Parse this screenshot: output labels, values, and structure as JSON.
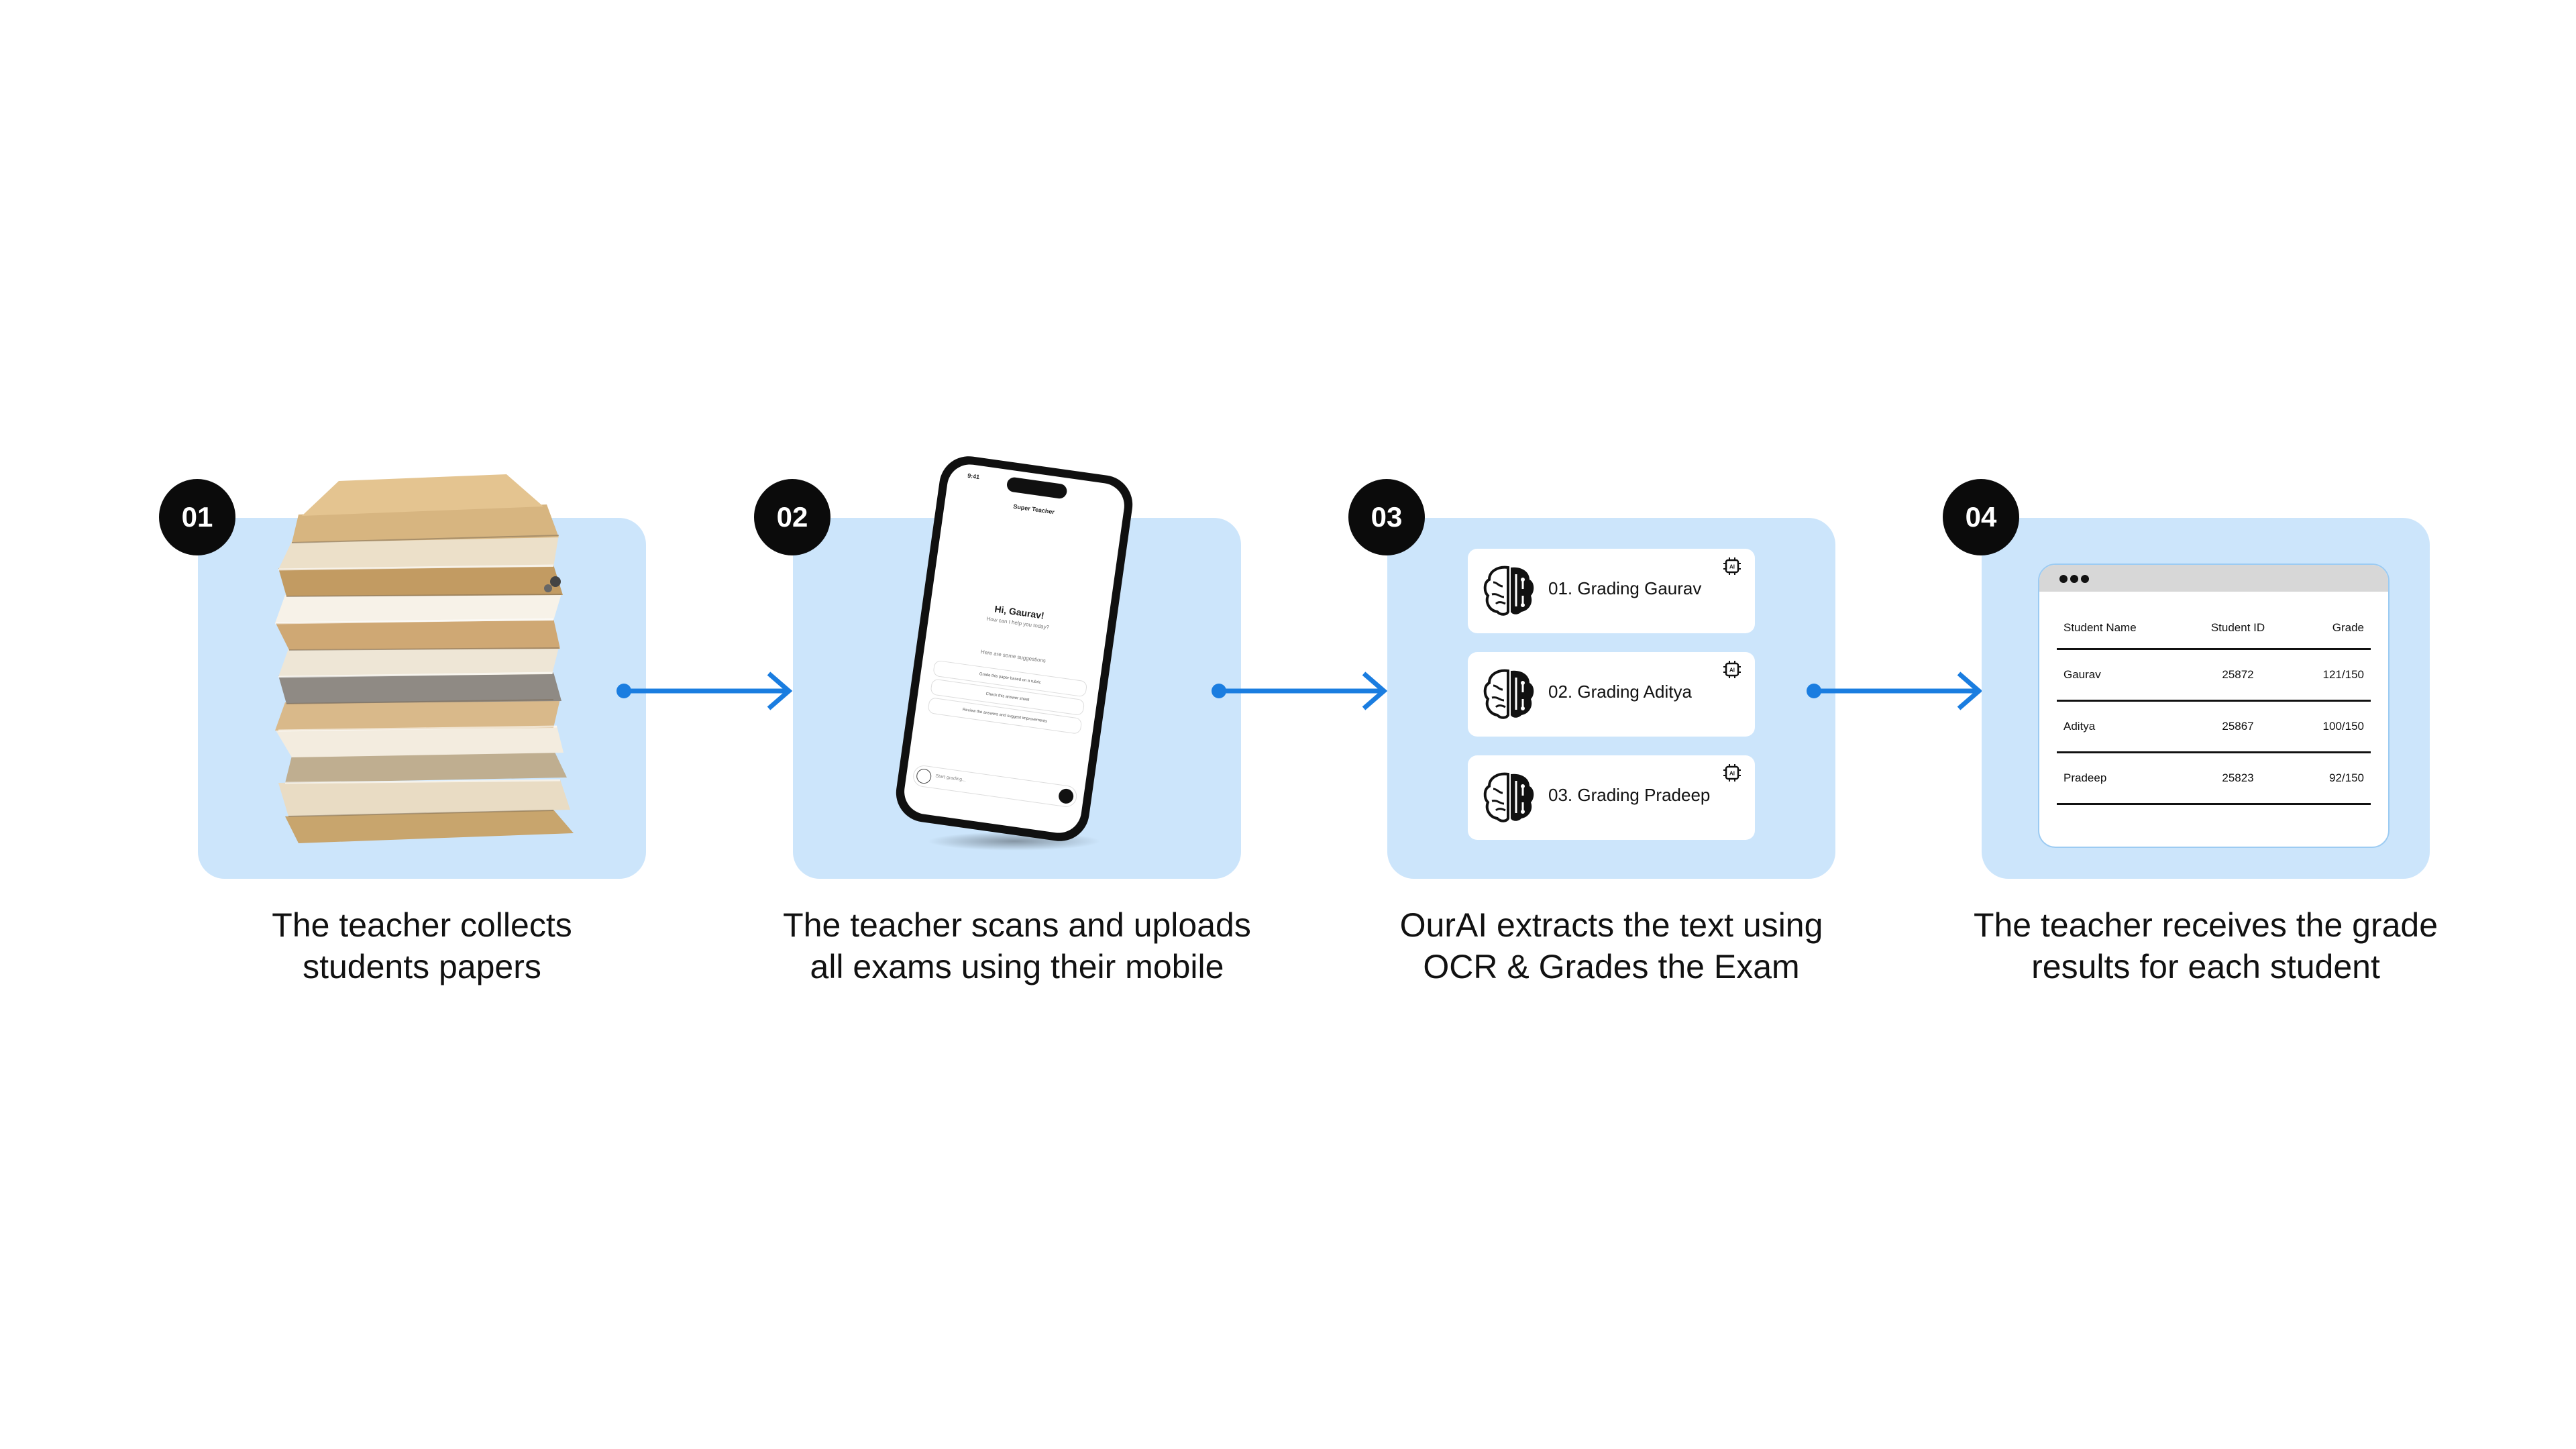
{
  "steps": [
    {
      "number": "01",
      "caption_line1": "The teacher collects",
      "caption_line2": "students papers"
    },
    {
      "number": "02",
      "caption_line1": "The teacher scans and uploads",
      "caption_line2": "all exams using their mobile"
    },
    {
      "number": "03",
      "caption_line1": "OurAI extracts the text using",
      "caption_line2": "OCR & Grades the Exam"
    },
    {
      "number": "04",
      "caption_line1": "The teacher receives the grade",
      "caption_line2": "results for each student"
    }
  ],
  "phone": {
    "time": "9:41",
    "app_name": "Super Teacher",
    "greeting": "Hi, Gaurav!",
    "subtitle": "How can I help you today?",
    "suggestions_label": "Here are some suggestions",
    "suggestions": [
      "Grade this paper based on a rubric",
      "Check this answer sheet",
      "Review the answers and suggest improvements"
    ],
    "input_placeholder": "Start grading..."
  },
  "grading": {
    "items": [
      {
        "label": "01. Grading Gaurav"
      },
      {
        "label": "02. Grading Aditya"
      },
      {
        "label": "03. Grading Pradeep"
      }
    ],
    "chip_text": "AI"
  },
  "results": {
    "headers": {
      "name": "Student Name",
      "id": "Student ID",
      "grade": "Grade"
    },
    "rows": [
      {
        "name": "Gaurav",
        "id": "25872",
        "grade": "121/150"
      },
      {
        "name": "Aditya",
        "id": "25867",
        "grade": "100/150"
      },
      {
        "name": "Pradeep",
        "id": "25823",
        "grade": "92/150"
      }
    ]
  },
  "colors": {
    "card_bg": "#cce5fb",
    "arrow": "#1a7de0",
    "badge": "#0b0b0b"
  }
}
